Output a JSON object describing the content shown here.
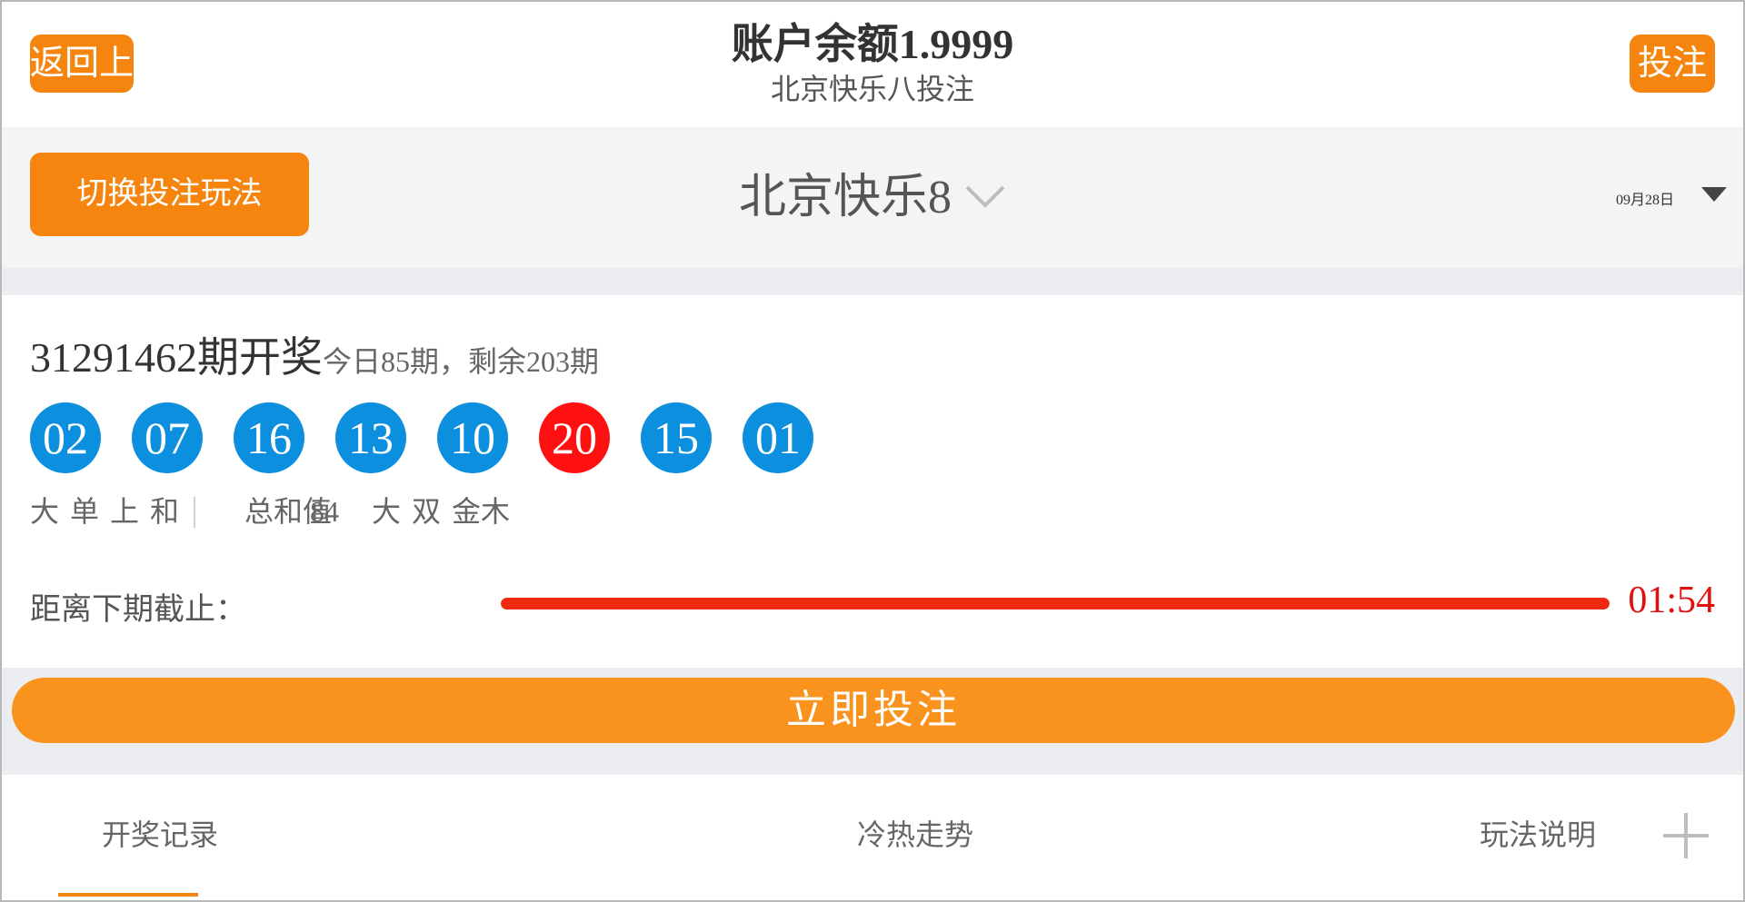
{
  "header": {
    "left_button": "返回上一页",
    "right_button": "投注记录",
    "title": "账户余额1.9999",
    "subtitle": "北京快乐八投注"
  },
  "selector": {
    "button": "切换投注玩法",
    "game_name": "北京快乐8",
    "date": "09月28日"
  },
  "result": {
    "draw_main": "31291462期开奖",
    "draw_extra": "今日85期，剩余203期",
    "balls": [
      {
        "number": "02",
        "color": "blue"
      },
      {
        "number": "07",
        "color": "blue"
      },
      {
        "number": "16",
        "color": "blue"
      },
      {
        "number": "13",
        "color": "blue"
      },
      {
        "number": "10",
        "color": "blue"
      },
      {
        "number": "20",
        "color": "red"
      },
      {
        "number": "15",
        "color": "blue"
      },
      {
        "number": "01",
        "color": "blue"
      }
    ],
    "stats": [
      "大",
      "单",
      "上",
      "和",
      "总和值",
      "84",
      "大",
      "双",
      "金木"
    ],
    "countdown_label": "距离下期截止：",
    "countdown_progress": 1.0,
    "countdown_time": "01:54"
  },
  "bet": {
    "button": "立即投注"
  },
  "tabs": [
    "开奖记录",
    "冷热走势",
    "玩法说明"
  ],
  "colors": {
    "accent": "#f5850f",
    "ball_blue": "#0b8fde",
    "ball_red": "#ff1010",
    "countdown": "#ef2a10"
  }
}
